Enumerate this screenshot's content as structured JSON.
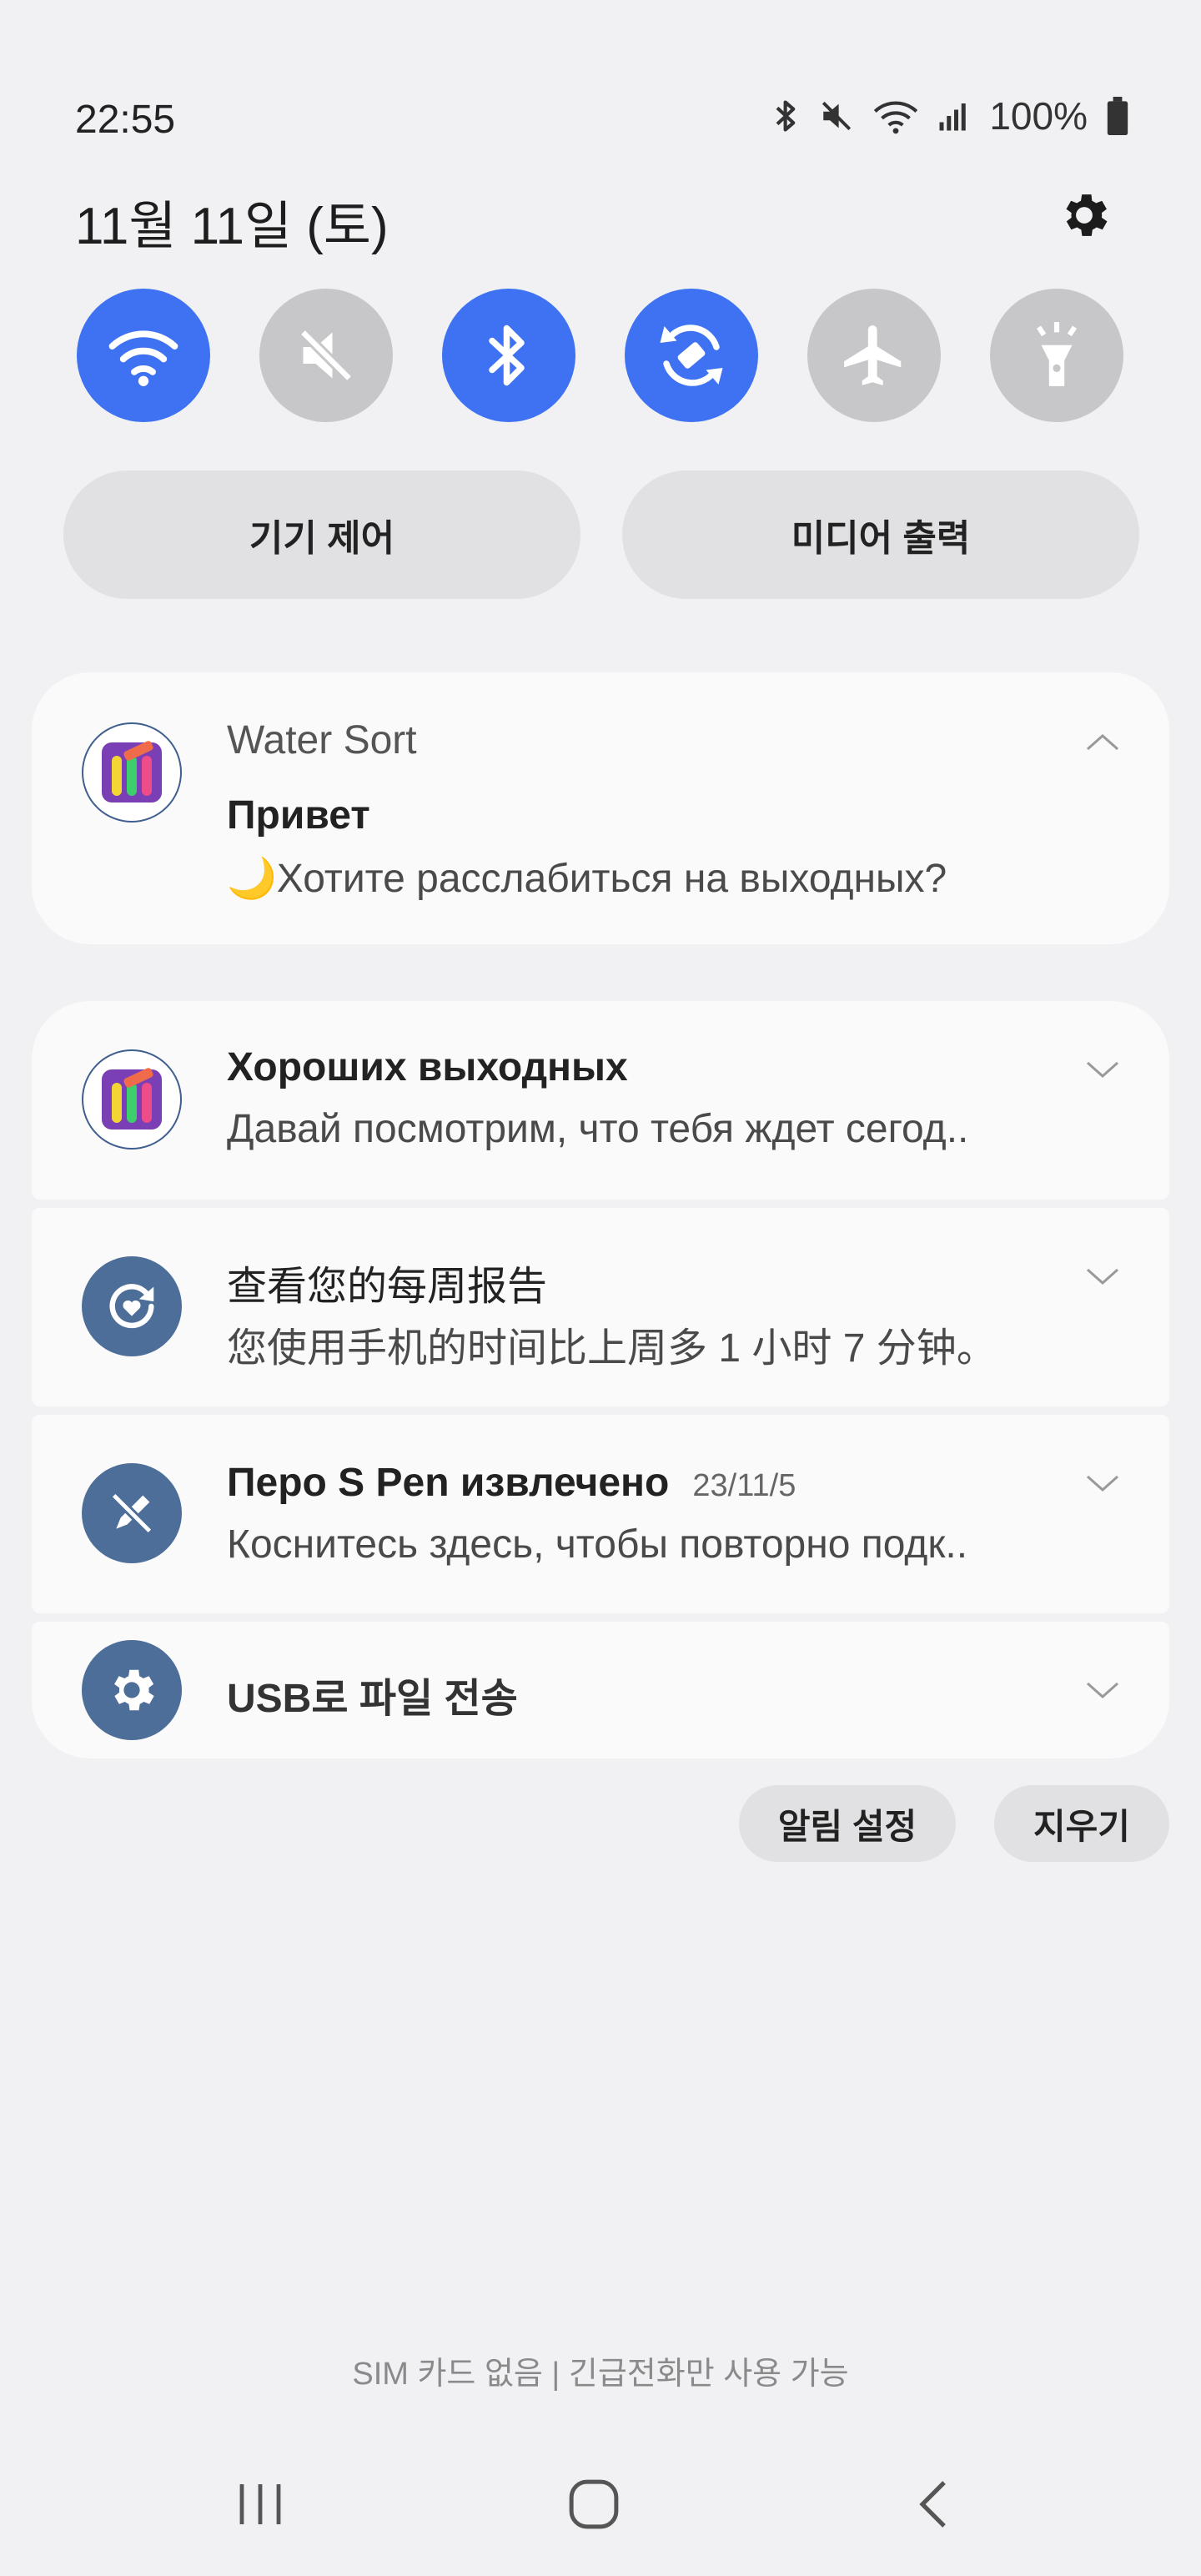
{
  "status_bar": {
    "time": "22:55",
    "battery_percent": "100%",
    "icons": [
      "bluetooth-icon",
      "mute-icon",
      "wifi-icon",
      "signal-icon",
      "battery-icon"
    ]
  },
  "date": "11월 11일 (토)",
  "quick_toggles": [
    {
      "name": "wifi",
      "icon": "wifi-icon",
      "state": "on"
    },
    {
      "name": "sound",
      "icon": "mute-icon",
      "state": "off"
    },
    {
      "name": "bluetooth",
      "icon": "bluetooth-icon",
      "state": "on"
    },
    {
      "name": "auto-rotate",
      "icon": "rotate-icon",
      "state": "on"
    },
    {
      "name": "airplane",
      "icon": "airplane-icon",
      "state": "off"
    },
    {
      "name": "flashlight",
      "icon": "flashlight-icon",
      "state": "off"
    }
  ],
  "pills": {
    "device_control": "기기 제어",
    "media_output": "미디어 출력"
  },
  "notifications": {
    "water_sort": {
      "app_name": "Water Sort",
      "title": "Привет",
      "body": "🌙Хотите расслабиться на выходных?"
    },
    "weekend": {
      "title": "Хороших выходных",
      "body": "Давай посмотрим, что тебя ждет сегод.."
    },
    "weekly_report": {
      "title": "查看您的每周报告",
      "body": "您使用手机的时间比上周多 1 小时 7 分钟。"
    },
    "spen": {
      "title": "Перо S Pen извлечено",
      "date": "23/11/5",
      "body": "Коснитесь здесь, чтобы повторно подк.."
    },
    "usb": {
      "title": "USB로 파일 전송"
    }
  },
  "actions": {
    "notification_settings": "알림 설정",
    "clear": "지우기"
  },
  "sim_status": "SIM 카드 없음 | 긴급전화만 사용 가능",
  "colors": {
    "accent": "#3e72f3",
    "toggle_off": "#c7c7c9",
    "background": "#f1f1f3"
  }
}
